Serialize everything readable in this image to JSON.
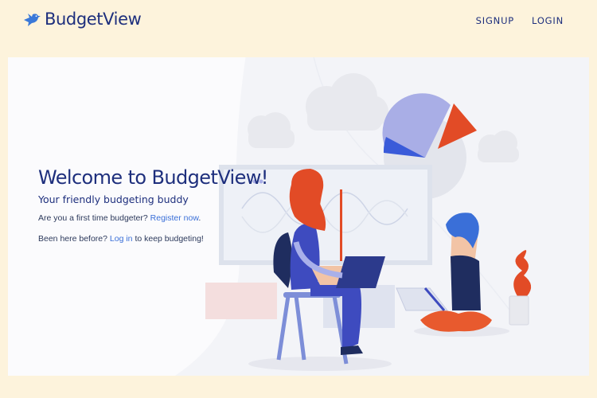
{
  "nav": {
    "brand": "BudgetView",
    "signup": "SIGNUP",
    "login": "LOGIN"
  },
  "hero": {
    "title": "Welcome to BudgetView!",
    "subtitle": "Your friendly budgeting buddy",
    "first_prefix": "Are you a first time budgeter?",
    "register_link": "Register now",
    "first_suffix": ".",
    "second_prefix": "Been here before?",
    "login_link": "Log in",
    "second_suffix": "to keep budgeting!"
  },
  "colors": {
    "background": "#fdf3dc",
    "brand": "#1e2f7d",
    "link": "#3a6fd8",
    "accent_orange": "#e85a2e"
  },
  "icons": {
    "logo": "bird-icon"
  }
}
